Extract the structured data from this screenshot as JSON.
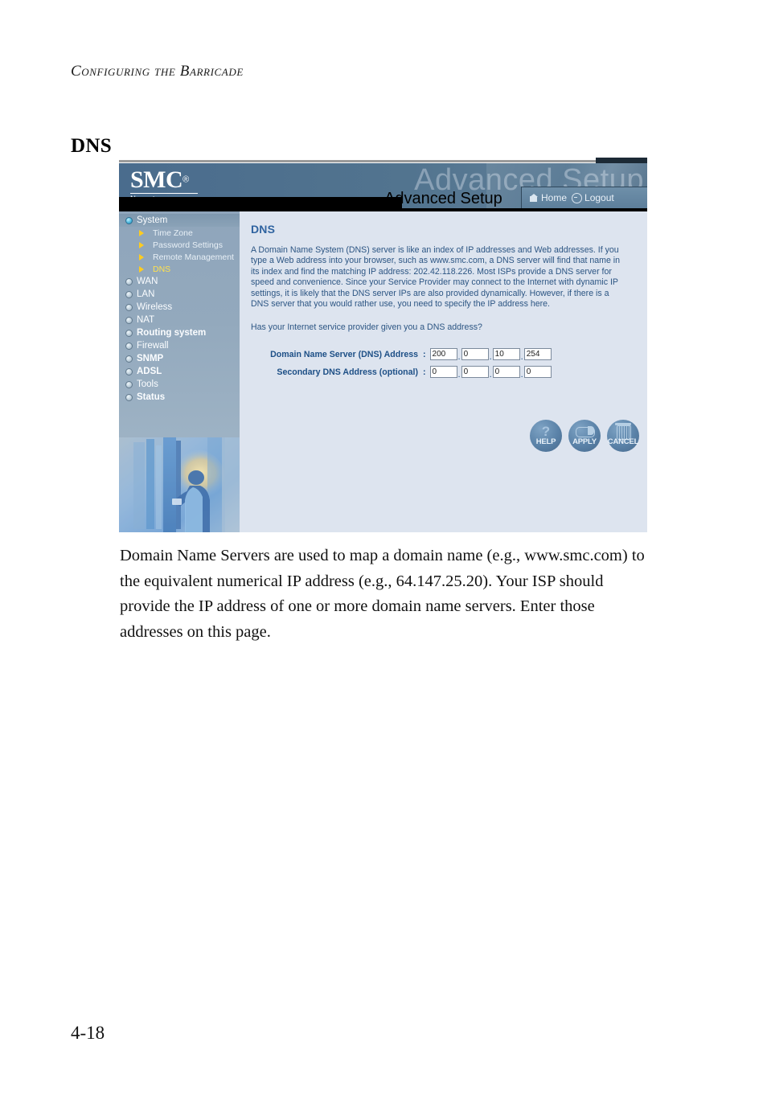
{
  "book": {
    "running_header": "Configuring the Barricade",
    "section_heading": "DNS",
    "paragraph": "Domain Name Servers are used to map a domain name (e.g., www.smc.com) to the equivalent numerical IP address (e.g., 64.147.25.20). Your ISP should provide the IP address of one or more domain name servers. Enter those addresses on this page.",
    "page_number": "4-18"
  },
  "router_ui": {
    "header": {
      "logo_text": "SMC",
      "logo_registered": "®",
      "logo_subtext": "N e t w o r k s",
      "watermark": "Advanced Setup",
      "title_bar_label": "Advanced Setup",
      "nav": [
        {
          "label": "Home",
          "icon": "home-icon"
        },
        {
          "label": "Logout",
          "icon": "logout-icon"
        }
      ]
    },
    "sidebar": {
      "items": [
        {
          "label": "System",
          "active": true,
          "bold": false
        },
        {
          "label": "WAN",
          "active": false,
          "bold": false
        },
        {
          "label": "LAN",
          "active": false,
          "bold": false
        },
        {
          "label": "Wireless",
          "active": false,
          "bold": false
        },
        {
          "label": "NAT",
          "active": false,
          "bold": false
        },
        {
          "label": "Routing system",
          "active": false,
          "bold": true
        },
        {
          "label": "Firewall",
          "active": false,
          "bold": false
        },
        {
          "label": "SNMP",
          "active": false,
          "bold": false
        },
        {
          "label": "ADSL",
          "active": false,
          "bold": false
        },
        {
          "label": "Tools",
          "active": false,
          "bold": false
        },
        {
          "label": "Status",
          "active": false,
          "bold": false
        }
      ],
      "sub_items": [
        {
          "label": "Time Zone",
          "selected": false
        },
        {
          "label": "Password Settings",
          "selected": false
        },
        {
          "label": "Remote Management",
          "selected": false
        },
        {
          "label": "DNS",
          "selected": true
        }
      ],
      "photo_alt": "technician at server rack"
    },
    "content": {
      "title": "DNS",
      "description": "A Domain Name System (DNS) server is like an index of IP addresses and Web addresses. If you type a Web address into your browser, such as www.smc.com, a DNS server will find that name in its index and find the matching IP address: 202.42.118.226. Most ISPs provide a DNS server for speed and convenience. Since your Service Provider may connect to the Internet with dynamic IP settings, it is likely that the DNS server IPs are also provided dynamically. However, if there is a DNS server that you would rather use, you need to specify the IP address here.",
      "question": "Has your Internet service provider given you a DNS address?",
      "fields": [
        {
          "label": "Domain Name Server (DNS) Address",
          "separator": ":",
          "octets": [
            "200",
            "0",
            "10",
            "254"
          ]
        },
        {
          "label": "Secondary DNS Address (optional)",
          "separator": ":",
          "octets": [
            "0",
            "0",
            "0",
            "0"
          ]
        }
      ],
      "buttons": [
        {
          "label": "HELP",
          "glyph": "question-mark"
        },
        {
          "label": "APPLY",
          "glyph": "eraser"
        },
        {
          "label": "CANCEL",
          "glyph": "trash-can"
        }
      ]
    },
    "colors": {
      "header_blue": "#4a6c8d",
      "sidebar_blue": "#93a9bd",
      "content_bg": "#dde4ef",
      "text_blue": "#2c5583",
      "label_blue": "#1d4f86",
      "accent_yellow": "#ffcc1f",
      "button_blue": "#5a82a8"
    }
  }
}
